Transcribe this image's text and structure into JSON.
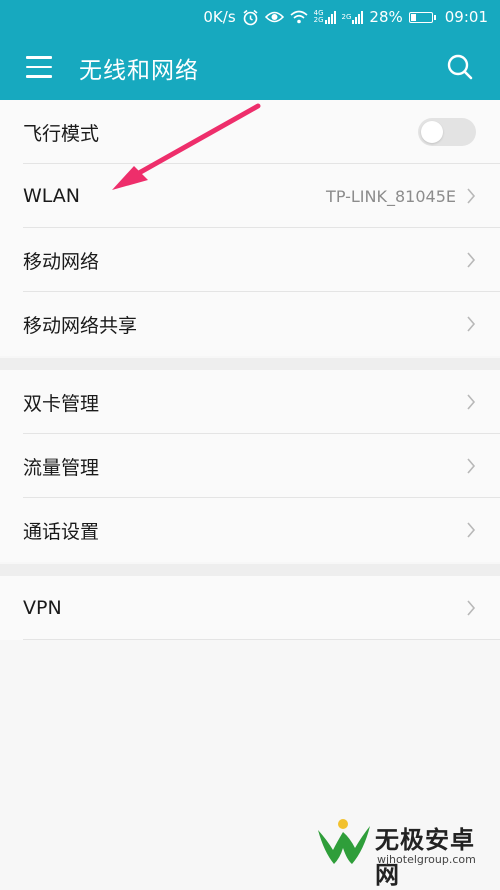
{
  "status_bar": {
    "speed": "0K/s",
    "net_tag_1": [
      "4G",
      "2G"
    ],
    "net_tag_2": "2G",
    "battery_percent_text": "28%",
    "battery_level": 0.28,
    "time": "09:01",
    "icons": [
      "alarm-icon",
      "eye-icon",
      "wifi-icon",
      "signal-icon"
    ]
  },
  "app_bar": {
    "title": "无线和网络",
    "icons": [
      "menu-icon",
      "search-icon"
    ],
    "color": "#17a9bf"
  },
  "groups": [
    {
      "rows": [
        {
          "label": "飞行模式",
          "control": "toggle",
          "on": false
        },
        {
          "label": "WLAN",
          "value": "TP-LINK_81045E",
          "control": "chevron"
        },
        {
          "label": "移动网络",
          "control": "chevron"
        },
        {
          "label": "移动网络共享",
          "control": "chevron"
        }
      ]
    },
    {
      "rows": [
        {
          "label": "双卡管理",
          "control": "chevron"
        },
        {
          "label": "流量管理",
          "control": "chevron"
        },
        {
          "label": "通话设置",
          "control": "chevron"
        }
      ]
    },
    {
      "rows": [
        {
          "label": "VPN",
          "control": "chevron"
        }
      ]
    }
  ],
  "annotation": {
    "type": "arrow",
    "color": "#ee2e6b",
    "points_to": "WLAN"
  },
  "watermark": {
    "text": "无极安卓网",
    "url": "wjhotelgroup.com",
    "colors": {
      "green": "#2f9e3a",
      "yellow": "#f2c12e"
    }
  }
}
